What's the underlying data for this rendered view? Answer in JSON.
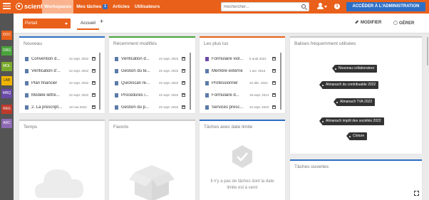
{
  "app": {
    "logo": "scienta"
  },
  "nav": [
    {
      "label": "Workspaces",
      "active": true
    },
    {
      "label": "Mes tâches",
      "badge": "1"
    },
    {
      "label": "Articles"
    },
    {
      "label": "Utilisateurs"
    }
  ],
  "search": {
    "placeholder": "Rechercher...",
    "icon": "search-icon"
  },
  "admin_button": "ACCÉDER À L'ADMINISTRATION",
  "sidebar": [
    {
      "label": "DOC",
      "color": "#e9601a"
    },
    {
      "label": "ORG",
      "color": "#4aa33c"
    },
    {
      "label": "MOL",
      "color": "#7aaa2c"
    },
    {
      "label": "LAB",
      "color": "#f0b400"
    },
    {
      "label": "MRQ",
      "color": "#6b4aa8"
    },
    {
      "label": "REG",
      "color": "#c0392b"
    },
    {
      "label": "ARC",
      "color": "#8e6ab4"
    }
  ],
  "toolbar": {
    "portal": "Portail",
    "tab": "Accueil",
    "add": "+",
    "modifier": "MODIFIER",
    "gerer": "GÉRER"
  },
  "panels": {
    "nouveau": {
      "title": "Nouveau",
      "accent": "#2e6fc6",
      "items": [
        {
          "name": "Convention d...",
          "date": "22 sept. 2022"
        },
        {
          "name": "Vérification d'...",
          "date": "22 sept. 2022"
        },
        {
          "name": "Plan financier",
          "date": "22 sept. 2022"
        },
        {
          "name": "Modèle lettre...",
          "date": "22 sept. 2022"
        },
        {
          "name": "2. La prescript...",
          "date": "19 mai 2022"
        }
      ]
    },
    "recents": {
      "title": "Récemment modifiés",
      "accent": "#4aa33c",
      "items": [
        {
          "name": "Vérification d...",
          "date": "22 sept. 2022"
        },
        {
          "name": "Gestion du te...",
          "date": "22 sept. 2022"
        },
        {
          "name": "Quickscan re...",
          "date": "22 sept. 2022"
        },
        {
          "name": "Procédures i...",
          "date": "22 sept. 2022"
        },
        {
          "name": "Gestion du p...",
          "date": "22 sept. 2022"
        }
      ]
    },
    "plus_lus": {
      "title": "Les plus lus",
      "accent": "#e9601a",
      "items": [
        {
          "name": "Formulaire viol...",
          "date": "6 août 2021"
        },
        {
          "name": "Membre externe",
          "date": "1 avr. 2016"
        },
        {
          "name": "Professionnel",
          "date": "22 déc. 2021"
        },
        {
          "name": "Formulaire d...",
          "date": "18 sept. 2014"
        },
        {
          "name": "Services presc...",
          "date": "22 sept. 2022"
        }
      ]
    },
    "balises": {
      "title": "Balises fréquemment utilisées",
      "tags": [
        "Nouveau collaborateur",
        "Almanach du contribuable 2022",
        "Almanach TVA 2022",
        "Almanach impôt des sociétés 2022",
        "Cloture"
      ]
    },
    "temps": {
      "title": "Temps"
    },
    "favoris": {
      "title": "Favoris"
    },
    "taches_limite": {
      "title": "Tâches avec date limite",
      "empty_line1": "Il n'y a pas de tâches dont la date",
      "empty_line2": "limite est à venir"
    },
    "taches_ouvertes": {
      "title": "Tâches ouvertes"
    }
  }
}
